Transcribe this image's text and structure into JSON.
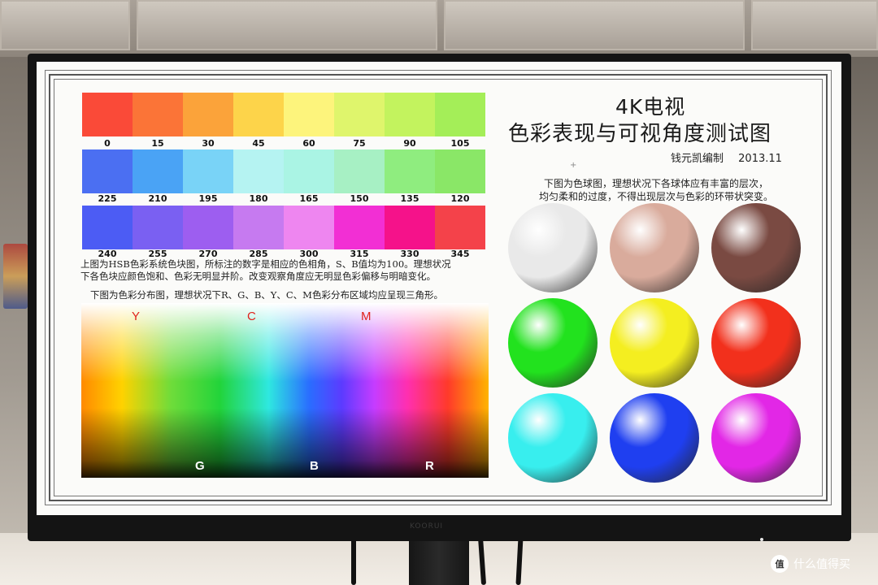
{
  "chart": {
    "title_line1": "4K电视",
    "title_line2": "色彩表现与可视角度测试图",
    "author": "钱元凯编制",
    "date": "2013.11",
    "hue_rows": [
      {
        "labels": [
          "0",
          "15",
          "30",
          "45",
          "60",
          "75",
          "90",
          "105"
        ],
        "colors": [
          "#fa4a38",
          "#fb7437",
          "#fba33a",
          "#fdd44a",
          "#fdf47c",
          "#dff56c",
          "#c3f35e",
          "#a4ee58"
        ]
      },
      {
        "labels": [
          "225",
          "210",
          "195",
          "180",
          "165",
          "150",
          "135",
          "120"
        ],
        "colors": [
          "#4b6ff2",
          "#4aa3f5",
          "#79d3f7",
          "#b5f3f2",
          "#aaf4e4",
          "#a7f0c4",
          "#8fed7f",
          "#8ae767"
        ]
      },
      {
        "labels": [
          "240",
          "255",
          "270",
          "285",
          "300",
          "315",
          "330",
          "345"
        ],
        "colors": [
          "#4c5cf4",
          "#7a60f2",
          "#9d5ef0",
          "#c67af0",
          "#ee86f0",
          "#f22fd4",
          "#f5128a",
          "#f4424a"
        ]
      }
    ],
    "hsb_description_line1": "上图为HSB色彩系统色块图，所标注的数字是相应的色相角，S、B值均为100。理想状况",
    "hsb_description_line2": "下各色块应颜色饱和、色彩无明显并阶。改变观察角度应无明显色彩偏移与明暗变化。",
    "distribution_description": "下图为色彩分布图，理想状况下R、G、B、Y、C、M色彩分布区域均应呈现三角形。",
    "distribution_top_labels": [
      "Y",
      "C",
      "M"
    ],
    "distribution_bottom_labels": [
      "G",
      "B",
      "R"
    ],
    "sphere_description_line1": "下图为色球图，理想状况下各球体应有丰富的层次，",
    "sphere_description_line2": "均匀柔和的过度，不得出现层次与色彩的环带状突变。",
    "spheres": [
      {
        "name": "white-sphere",
        "color": "#e9e9e9"
      },
      {
        "name": "skin-sphere",
        "color": "#d9ab9c"
      },
      {
        "name": "brown-sphere",
        "color": "#7a4a42"
      },
      {
        "name": "green-sphere",
        "color": "#22e21e"
      },
      {
        "name": "yellow-sphere",
        "color": "#f4ee20"
      },
      {
        "name": "red-sphere",
        "color": "#f2301c"
      },
      {
        "name": "cyan-sphere",
        "color": "#38eeee"
      },
      {
        "name": "blue-sphere",
        "color": "#1f3ff0"
      },
      {
        "name": "magenta-sphere",
        "color": "#e227e6"
      }
    ]
  },
  "monitor": {
    "brand": "KOORUI"
  },
  "watermark": {
    "icon_glyph": "值",
    "text": "什么值得买"
  }
}
